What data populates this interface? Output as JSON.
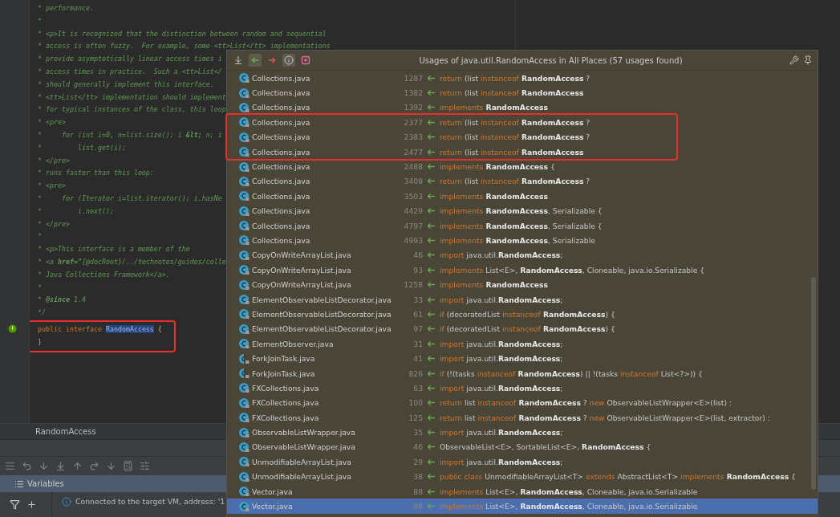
{
  "editor": {
    "lines": [
      {
        "kind": "comment",
        "text": "* performance."
      },
      {
        "kind": "comment",
        "text": "*"
      },
      {
        "kind": "comment",
        "text": "* <p>It is recognized that the distinction between random and sequential"
      },
      {
        "kind": "comment",
        "text": "* access is often fuzzy.  For example, some <tt>List</tt> implementations"
      },
      {
        "kind": "comment",
        "text": "* provide asymptotically linear access times i"
      },
      {
        "kind": "comment",
        "text": "* access times in practice.  Such a <tt>List</"
      },
      {
        "kind": "comment",
        "text": "* should generally implement this interface."
      },
      {
        "kind": "comment",
        "text": "* <tt>List</tt> implementation should implement"
      },
      {
        "kind": "comment",
        "text": "* for typical instances of the class, this loop"
      },
      {
        "kind": "comment",
        "text": "* <pre>"
      },
      {
        "kind": "comment",
        "text": "*     for (int i=0, n=list.size(); i **&lt;** n; i"
      },
      {
        "kind": "comment",
        "text": "*         list.get(i);"
      },
      {
        "kind": "comment",
        "text": "* </pre>"
      },
      {
        "kind": "comment",
        "text": "* runs faster than this loop:"
      },
      {
        "kind": "comment",
        "text": "* <pre>"
      },
      {
        "kind": "comment",
        "text": "*     for (Iterator i=list.iterator(); i.hasNe"
      },
      {
        "kind": "comment",
        "text": "*         i.next();"
      },
      {
        "kind": "comment",
        "text": "* </pre>"
      },
      {
        "kind": "comment",
        "text": "*"
      },
      {
        "kind": "comment",
        "text": "* <p>This interface is a member of the"
      },
      {
        "kind": "comment",
        "text": "* <a **href=\"**{@docRoot}/../technotes/guides/colle"
      },
      {
        "kind": "comment",
        "text": "* Java Collections Framework</a>."
      },
      {
        "kind": "comment",
        "text": "*"
      },
      {
        "kind": "comment",
        "text": "* **@since** 1.4"
      },
      {
        "kind": "comment",
        "text": "*/"
      },
      {
        "kind": "code",
        "marker": true,
        "framed": true,
        "tokens": [
          {
            "kind": "keyword",
            "text": "public interface "
          },
          {
            "kind": "highlight",
            "text": "RandomAccess"
          },
          {
            "kind": "plain",
            "text": " {"
          }
        ]
      },
      {
        "kind": "code",
        "marker": false,
        "framed": true,
        "tokens": [
          {
            "kind": "plain",
            "text": "}"
          }
        ]
      }
    ],
    "breadcrumb": "RandomAccess"
  },
  "debugger": {
    "tab": "Variables",
    "message": "Connected to the target VM, address: '1"
  },
  "usages": {
    "title": "Usages of java.util.RandomAccess in All Places (57 usages found)",
    "rows": [
      {
        "file": "Collections.java",
        "line": "1287",
        "kind": "class",
        "selected": false,
        "code": [
          {
            "kind": "keyword",
            "text": "return"
          },
          {
            "kind": "plain",
            "text": " (list "
          },
          {
            "kind": "keyword",
            "text": "instanceof"
          },
          {
            "kind": "bold",
            "text": " RandomAccess"
          },
          {
            "kind": "plain",
            "text": " ?"
          }
        ]
      },
      {
        "file": "Collections.java",
        "line": "1382",
        "kind": "class",
        "selected": false,
        "code": [
          {
            "kind": "keyword",
            "text": "return"
          },
          {
            "kind": "plain",
            "text": " (list "
          },
          {
            "kind": "keyword",
            "text": "instanceof"
          },
          {
            "kind": "bold",
            "text": " RandomAccess"
          }
        ]
      },
      {
        "file": "Collections.java",
        "line": "1392",
        "kind": "class",
        "selected": false,
        "code": [
          {
            "kind": "keyword",
            "text": "implements"
          },
          {
            "kind": "bold",
            "text": " RandomAccess"
          }
        ]
      },
      {
        "file": "Collections.java",
        "line": "2377",
        "kind": "class",
        "selected": false,
        "framed": true,
        "code": [
          {
            "kind": "keyword",
            "text": "return"
          },
          {
            "kind": "plain",
            "text": " (list "
          },
          {
            "kind": "keyword",
            "text": "instanceof"
          },
          {
            "kind": "bold",
            "text": " RandomAccess"
          },
          {
            "kind": "plain",
            "text": " ?"
          }
        ]
      },
      {
        "file": "Collections.java",
        "line": "2383",
        "kind": "class",
        "selected": false,
        "framed": true,
        "code": [
          {
            "kind": "keyword",
            "text": "return"
          },
          {
            "kind": "plain",
            "text": " (list "
          },
          {
            "kind": "keyword",
            "text": "instanceof"
          },
          {
            "kind": "bold",
            "text": " RandomAccess"
          },
          {
            "kind": "plain",
            "text": " ?"
          }
        ]
      },
      {
        "file": "Collections.java",
        "line": "2477",
        "kind": "class",
        "selected": false,
        "framed": true,
        "code": [
          {
            "kind": "keyword",
            "text": "return"
          },
          {
            "kind": "plain",
            "text": " (list "
          },
          {
            "kind": "keyword",
            "text": "instanceof"
          },
          {
            "kind": "bold",
            "text": " RandomAccess"
          }
        ]
      },
      {
        "file": "Collections.java",
        "line": "2488",
        "kind": "class",
        "selected": false,
        "code": [
          {
            "kind": "keyword",
            "text": "implements"
          },
          {
            "kind": "bold",
            "text": " RandomAccess"
          },
          {
            "kind": "plain",
            "text": " {"
          }
        ]
      },
      {
        "file": "Collections.java",
        "line": "3408",
        "kind": "class",
        "selected": false,
        "code": [
          {
            "kind": "keyword",
            "text": "return"
          },
          {
            "kind": "plain",
            "text": " (list "
          },
          {
            "kind": "keyword",
            "text": "instanceof"
          },
          {
            "kind": "bold",
            "text": " RandomAccess"
          },
          {
            "kind": "plain",
            "text": " ?"
          }
        ]
      },
      {
        "file": "Collections.java",
        "line": "3503",
        "kind": "class",
        "selected": false,
        "code": [
          {
            "kind": "keyword",
            "text": "implements"
          },
          {
            "kind": "bold",
            "text": " RandomAccess"
          }
        ]
      },
      {
        "file": "Collections.java",
        "line": "4429",
        "kind": "class",
        "selected": false,
        "code": [
          {
            "kind": "keyword",
            "text": "implements"
          },
          {
            "kind": "bold",
            "text": " RandomAccess"
          },
          {
            "kind": "plain",
            "text": ", Serializable {"
          }
        ]
      },
      {
        "file": "Collections.java",
        "line": "4797",
        "kind": "class",
        "selected": false,
        "code": [
          {
            "kind": "keyword",
            "text": "implements"
          },
          {
            "kind": "bold",
            "text": " RandomAccess"
          },
          {
            "kind": "plain",
            "text": ", Serializable {"
          }
        ]
      },
      {
        "file": "Collections.java",
        "line": "4993",
        "kind": "class",
        "selected": false,
        "code": [
          {
            "kind": "keyword",
            "text": "implements"
          },
          {
            "kind": "bold",
            "text": " RandomAccess"
          },
          {
            "kind": "plain",
            "text": ", Serializable"
          }
        ]
      },
      {
        "file": "CopyOnWriteArrayList.java",
        "line": "46",
        "kind": "class",
        "selected": false,
        "code": [
          {
            "kind": "keyword",
            "text": "import"
          },
          {
            "kind": "plain",
            "text": " java.util."
          },
          {
            "kind": "bold",
            "text": "RandomAccess"
          },
          {
            "kind": "plain",
            "text": ";"
          }
        ]
      },
      {
        "file": "CopyOnWriteArrayList.java",
        "line": "93",
        "kind": "class",
        "selected": false,
        "code": [
          {
            "kind": "keyword",
            "text": "implements"
          },
          {
            "kind": "plain",
            "text": " List<E>, "
          },
          {
            "kind": "bold",
            "text": "RandomAccess"
          },
          {
            "kind": "plain",
            "text": ", Cloneable, java.io.Serializable {"
          }
        ]
      },
      {
        "file": "CopyOnWriteArrayList.java",
        "line": "1258",
        "kind": "class",
        "selected": false,
        "code": [
          {
            "kind": "keyword",
            "text": "implements"
          },
          {
            "kind": "bold",
            "text": " RandomAccess"
          }
        ]
      },
      {
        "file": "ElementObservableListDecorator.java",
        "line": "33",
        "kind": "class",
        "selected": false,
        "code": [
          {
            "kind": "keyword",
            "text": "import"
          },
          {
            "kind": "plain",
            "text": " java.util."
          },
          {
            "kind": "bold",
            "text": "RandomAccess"
          },
          {
            "kind": "plain",
            "text": ";"
          }
        ]
      },
      {
        "file": "ElementObservableListDecorator.java",
        "line": "61",
        "kind": "class",
        "selected": false,
        "code": [
          {
            "kind": "keyword",
            "text": "if"
          },
          {
            "kind": "plain",
            "text": " (decoratedList "
          },
          {
            "kind": "keyword",
            "text": "instanceof"
          },
          {
            "kind": "bold",
            "text": " RandomAccess"
          },
          {
            "kind": "plain",
            "text": ") {"
          }
        ]
      },
      {
        "file": "ElementObservableListDecorator.java",
        "line": "97",
        "kind": "class",
        "selected": false,
        "code": [
          {
            "kind": "keyword",
            "text": "if"
          },
          {
            "kind": "plain",
            "text": " (decoratedList "
          },
          {
            "kind": "keyword",
            "text": "instanceof"
          },
          {
            "kind": "bold",
            "text": " RandomAccess"
          },
          {
            "kind": "plain",
            "text": ") {"
          }
        ]
      },
      {
        "file": "ElementObserver.java",
        "line": "31",
        "kind": "class",
        "selected": false,
        "code": [
          {
            "kind": "keyword",
            "text": "import"
          },
          {
            "kind": "plain",
            "text": " java.util."
          },
          {
            "kind": "bold",
            "text": "RandomAccess"
          },
          {
            "kind": "plain",
            "text": ";"
          }
        ]
      },
      {
        "file": "ForkJoinTask.java",
        "line": "41",
        "kind": "abstract",
        "selected": false,
        "code": [
          {
            "kind": "keyword",
            "text": "import"
          },
          {
            "kind": "plain",
            "text": " java.util."
          },
          {
            "kind": "bold",
            "text": "RandomAccess"
          },
          {
            "kind": "plain",
            "text": ";"
          }
        ]
      },
      {
        "file": "ForkJoinTask.java",
        "line": "826",
        "kind": "abstract",
        "selected": false,
        "code": [
          {
            "kind": "keyword",
            "text": "if"
          },
          {
            "kind": "plain",
            "text": " (!(tasks "
          },
          {
            "kind": "keyword",
            "text": "instanceof"
          },
          {
            "kind": "bold",
            "text": " RandomAccess"
          },
          {
            "kind": "plain",
            "text": ") || !(tasks "
          },
          {
            "kind": "keyword",
            "text": "instanceof"
          },
          {
            "kind": "plain",
            "text": " List<?>)) {"
          }
        ]
      },
      {
        "file": "FXCollections.java",
        "line": "63",
        "kind": "class",
        "selected": false,
        "code": [
          {
            "kind": "keyword",
            "text": "import"
          },
          {
            "kind": "plain",
            "text": " java.util."
          },
          {
            "kind": "bold",
            "text": "RandomAccess"
          },
          {
            "kind": "plain",
            "text": ";"
          }
        ]
      },
      {
        "file": "FXCollections.java",
        "line": "100",
        "kind": "class",
        "selected": false,
        "code": [
          {
            "kind": "keyword",
            "text": "return"
          },
          {
            "kind": "plain",
            "text": " list "
          },
          {
            "kind": "keyword",
            "text": "instanceof"
          },
          {
            "kind": "bold",
            "text": " RandomAccess"
          },
          {
            "kind": "plain",
            "text": " ? "
          },
          {
            "kind": "keyword",
            "text": "new"
          },
          {
            "kind": "plain",
            "text": " ObservableListWrapper<E>(list) :"
          }
        ]
      },
      {
        "file": "FXCollections.java",
        "line": "125",
        "kind": "class",
        "selected": false,
        "code": [
          {
            "kind": "keyword",
            "text": "return"
          },
          {
            "kind": "plain",
            "text": " list "
          },
          {
            "kind": "keyword",
            "text": "instanceof"
          },
          {
            "kind": "bold",
            "text": " RandomAccess"
          },
          {
            "kind": "plain",
            "text": " ? "
          },
          {
            "kind": "keyword",
            "text": "new"
          },
          {
            "kind": "plain",
            "text": " ObservableListWrapper<E>(list, extractor) :"
          }
        ]
      },
      {
        "file": "ObservableListWrapper.java",
        "line": "35",
        "kind": "class",
        "selected": false,
        "code": [
          {
            "kind": "keyword",
            "text": "import"
          },
          {
            "kind": "plain",
            "text": " java.util."
          },
          {
            "kind": "bold",
            "text": "RandomAccess"
          },
          {
            "kind": "plain",
            "text": ";"
          }
        ]
      },
      {
        "file": "ObservableListWrapper.java",
        "line": "46",
        "kind": "class",
        "selected": false,
        "code": [
          {
            "kind": "plain",
            "text": "ObservableList<E>, SortableList<E>, "
          },
          {
            "kind": "bold",
            "text": "RandomAccess"
          },
          {
            "kind": "plain",
            "text": " {"
          }
        ]
      },
      {
        "file": "UnmodifiableArrayList.java",
        "line": "29",
        "kind": "class",
        "selected": false,
        "code": [
          {
            "kind": "keyword",
            "text": "import"
          },
          {
            "kind": "plain",
            "text": " java.util."
          },
          {
            "kind": "bold",
            "text": "RandomAccess"
          },
          {
            "kind": "plain",
            "text": ";"
          }
        ]
      },
      {
        "file": "UnmodifiableArrayList.java",
        "line": "38",
        "kind": "class",
        "selected": false,
        "code": [
          {
            "kind": "keyword",
            "text": "public class"
          },
          {
            "kind": "plain",
            "text": " UnmodifiableArrayList<T> "
          },
          {
            "kind": "keyword",
            "text": "extends"
          },
          {
            "kind": "plain",
            "text": " AbstractList<T> "
          },
          {
            "kind": "keyword",
            "text": "implements"
          },
          {
            "kind": "bold",
            "text": " RandomAccess"
          },
          {
            "kind": "plain",
            "text": " {"
          }
        ]
      },
      {
        "file": "Vector.java",
        "line": "88",
        "kind": "class",
        "selected": false,
        "code": [
          {
            "kind": "keyword",
            "text": "implements"
          },
          {
            "kind": "plain",
            "text": " List<E>, "
          },
          {
            "kind": "bold",
            "text": "RandomAccess"
          },
          {
            "kind": "plain",
            "text": ", Cloneable, java.io.Serializable"
          }
        ]
      },
      {
        "file": "Vector.java",
        "line": "88",
        "kind": "class",
        "selected": true,
        "code": [
          {
            "kind": "keyword",
            "text": "implements"
          },
          {
            "kind": "plain",
            "text": " List<E>, "
          },
          {
            "kind": "bold",
            "text": "RandomAccess"
          },
          {
            "kind": "plain",
            "text": ", Cloneable, java.io.Serializable"
          }
        ]
      }
    ]
  }
}
